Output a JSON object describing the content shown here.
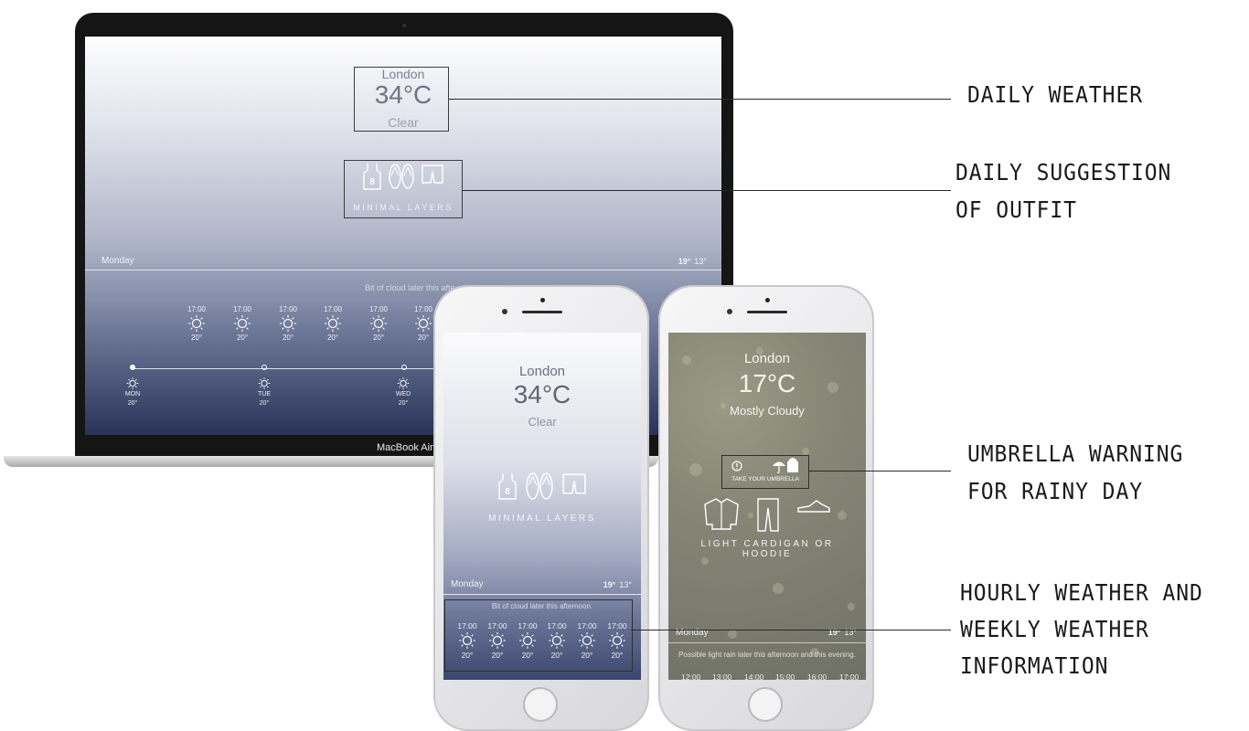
{
  "laptop": {
    "brand": "MacBook Air",
    "screen": {
      "city": "London",
      "temperature": "34°C",
      "condition": "Clear",
      "outfit_label": "MINIMAL LAYERS",
      "outfit_icons": [
        "tank-top-icon",
        "flip-flops-icon",
        "shorts-icon"
      ],
      "day": "Monday",
      "high": "19°",
      "low": "13°",
      "summary": "Bit of cloud later this afte",
      "hourly": [
        {
          "time": "17:00",
          "temp": "20°"
        },
        {
          "time": "17:00",
          "temp": "20°"
        },
        {
          "time": "17:00",
          "temp": "20°"
        },
        {
          "time": "17:00",
          "temp": "20°"
        },
        {
          "time": "17:00",
          "temp": "20°"
        },
        {
          "time": "17:00",
          "temp": "20°"
        }
      ],
      "weekly": [
        {
          "day": "MON",
          "temp": "20°"
        },
        {
          "day": "TUE",
          "temp": "20°"
        },
        {
          "day": "WED",
          "temp": "20°"
        }
      ]
    }
  },
  "phone_a": {
    "city": "London",
    "temperature": "34°C",
    "condition": "Clear",
    "outfit_label": "MINIMAL LAYERS",
    "outfit_icons": [
      "tank-top-icon",
      "flip-flops-icon",
      "shorts-icon"
    ],
    "jersey_number": "8",
    "day": "Monday",
    "high": "19°",
    "low": "13°",
    "summary": "Bit of cloud later this afternoon.",
    "hourly": [
      {
        "time": "17:00",
        "temp": "20°"
      },
      {
        "time": "17:00",
        "temp": "20°"
      },
      {
        "time": "17:00",
        "temp": "20°"
      },
      {
        "time": "17:00",
        "temp": "20°"
      },
      {
        "time": "17:00",
        "temp": "20°"
      },
      {
        "time": "17:00",
        "temp": "20°"
      }
    ]
  },
  "phone_b": {
    "city": "London",
    "temperature": "17°C",
    "condition": "Mostly Cloudy",
    "warning": "TAKE YOUR UMBRELLA",
    "warning_icons": [
      "alert-icon",
      "umbrella-icon",
      "raincoat-icon"
    ],
    "outfit_label_line1": "LIGHT CARDIGAN OR",
    "outfit_label_line2": "HOODIE",
    "outfit_icons": [
      "cardigan-icon",
      "trousers-icon",
      "sneaker-icon"
    ],
    "day": "Monday",
    "high": "19°",
    "low": "13°",
    "summary": "Possible light rain later this afternoon and this evening.",
    "hourly_times": [
      "12:00",
      "13:00",
      "14:00",
      "15:00",
      "16:00",
      "17:00"
    ]
  },
  "callouts": {
    "daily_weather": "DAILY WEATHER",
    "outfit_line1": "DAILY SUGGESTION",
    "outfit_line2": "OF OUTFIT",
    "umbrella_line1": "UMBRELLA WARNING",
    "umbrella_line2": "FOR RAINY DAY",
    "hourly_line1": "HOURLY WEATHER AND",
    "hourly_line2": "WEEKLY WEATHER",
    "hourly_line3": "INFORMATION"
  },
  "colors": {
    "callout_text": "#1a1a1a",
    "screen_text_dark": "#7b7f8e",
    "screen_text_light": "#f2f3f7"
  }
}
